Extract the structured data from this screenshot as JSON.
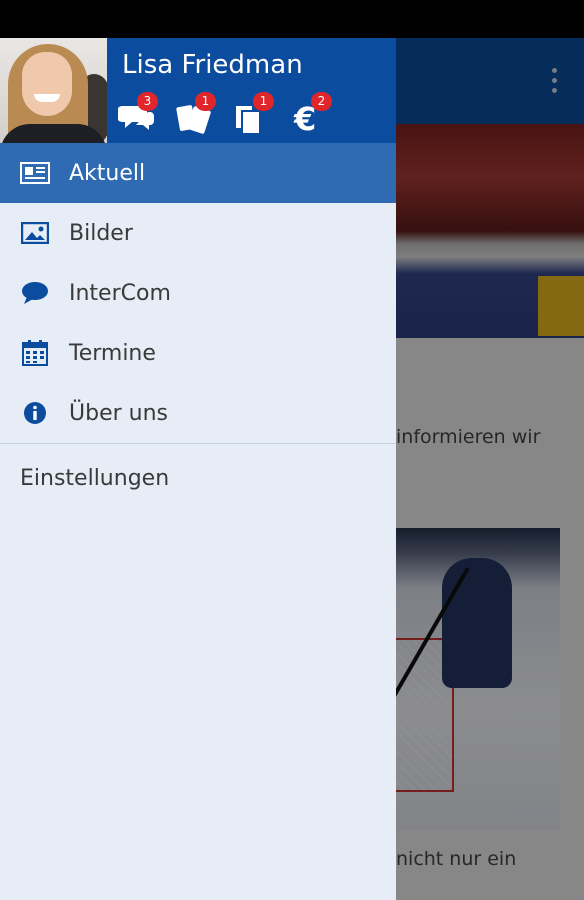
{
  "user": {
    "name": "Lisa Friedman"
  },
  "badges": [
    {
      "icon": "chat-bubbles-icon",
      "count": "3"
    },
    {
      "icon": "tickets-icon",
      "count": "1"
    },
    {
      "icon": "documents-icon",
      "count": "1"
    },
    {
      "icon": "euro-icon",
      "count": "2"
    }
  ],
  "menu": [
    {
      "label": "Aktuell",
      "icon": "newspaper-icon",
      "active": true
    },
    {
      "label": "Bilder",
      "icon": "image-icon",
      "active": false
    },
    {
      "label": "InterCom",
      "icon": "chat-bubble-icon",
      "active": false
    },
    {
      "label": "Termine",
      "icon": "calendar-icon",
      "active": false
    },
    {
      "label": "Über uns",
      "icon": "info-icon",
      "active": false
    }
  ],
  "settings_label": "Einstellungen",
  "background": {
    "text_1": "informieren wir",
    "text_2": "nicht nur ein"
  },
  "colors": {
    "primary": "#0c4c9e",
    "active": "#2e6bb2",
    "drawer_bg": "#e6edf6",
    "badge": "#e0262a"
  }
}
